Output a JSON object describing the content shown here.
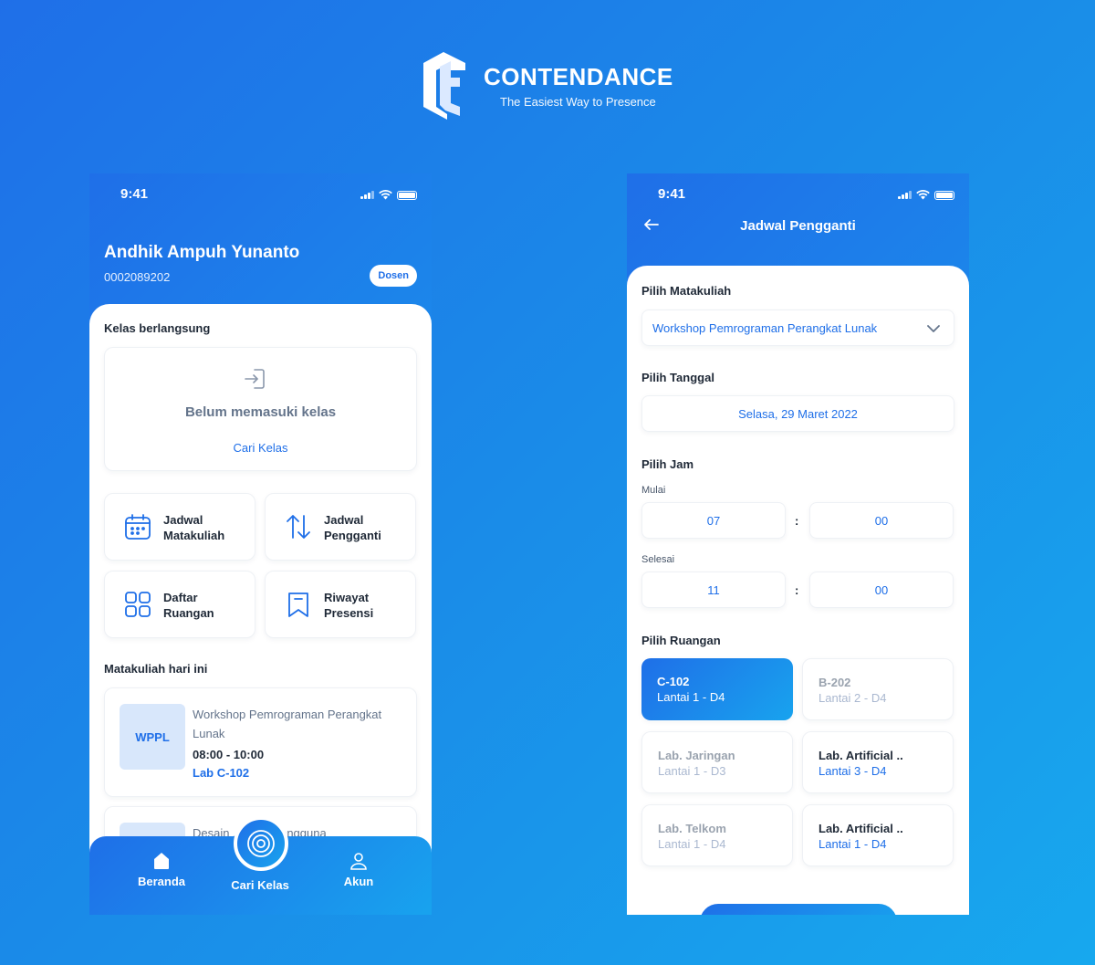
{
  "brand": {
    "name": "CONTENDANCE",
    "tagline": "The Easiest Way to Presence"
  },
  "status_bar": {
    "time": "9:41"
  },
  "home": {
    "profile": {
      "name": "Andhik Ampuh Yunanto",
      "id": "0002089202",
      "role": "Dosen"
    },
    "current_class": {
      "title": "Kelas berlangsung",
      "empty_text": "Belum memasuki kelas",
      "link": "Cari Kelas"
    },
    "menu": [
      {
        "label": "Jadwal Matakuliah",
        "icon": "calendar-icon"
      },
      {
        "label": "Jadwal Pengganti",
        "icon": "swap-arrows-icon"
      },
      {
        "label": "Daftar Ruangan",
        "icon": "grid-icon"
      },
      {
        "label": "Riwayat Presensi",
        "icon": "bookmark-icon"
      }
    ],
    "today": {
      "title": "Matakuliah hari ini",
      "courses": [
        {
          "code": "WPPL",
          "name": "Workshop Pemrograman Perangkat Lunak",
          "time": "08:00 - 10:00",
          "room": "Lab C-102"
        },
        {
          "code": "",
          "name": "Desain ... man Pengguna",
          "time": "",
          "room": ""
        }
      ]
    },
    "nav": [
      {
        "label": "Beranda",
        "icon": "home-icon"
      },
      {
        "label": "Cari Kelas",
        "icon": "radar-icon"
      },
      {
        "label": "Akun",
        "icon": "user-icon"
      }
    ]
  },
  "substitute": {
    "title": "Jadwal Pengganti",
    "course_label": "Pilih Matakuliah",
    "course_value": "Workshop Pemrograman Perangkat Lunak",
    "date_label": "Pilih Tanggal",
    "date_value": "Selasa, 29 Maret 2022",
    "time_label": "Pilih Jam",
    "start_label": "Mulai",
    "start_hour": "07",
    "start_minute": "00",
    "end_label": "Selesai",
    "end_hour": "11",
    "end_minute": "00",
    "time_separator": ":",
    "room_label": "Pilih Ruangan",
    "rooms": [
      {
        "name": "C-102",
        "floor": "Lantai 1 - D4",
        "state": "selected"
      },
      {
        "name": "B-202",
        "floor": "Lantai 2 - D4",
        "state": "disabled"
      },
      {
        "name": "Lab. Jaringan",
        "floor": "Lantai 1 - D3",
        "state": "disabled"
      },
      {
        "name": "Lab. Artificial ..",
        "floor": "Lantai 3 - D4",
        "state": "active"
      },
      {
        "name": "Lab. Telkom",
        "floor": "Lantai 1 - D4",
        "state": "disabled"
      },
      {
        "name": "Lab. Artificial ..",
        "floor": "Lantai 1 - D4",
        "state": "active"
      }
    ]
  },
  "colors": {
    "primary": "#1f6fe8",
    "accent": "#18a3ee",
    "text_dark": "#1f2937",
    "text_muted": "#64748b"
  }
}
